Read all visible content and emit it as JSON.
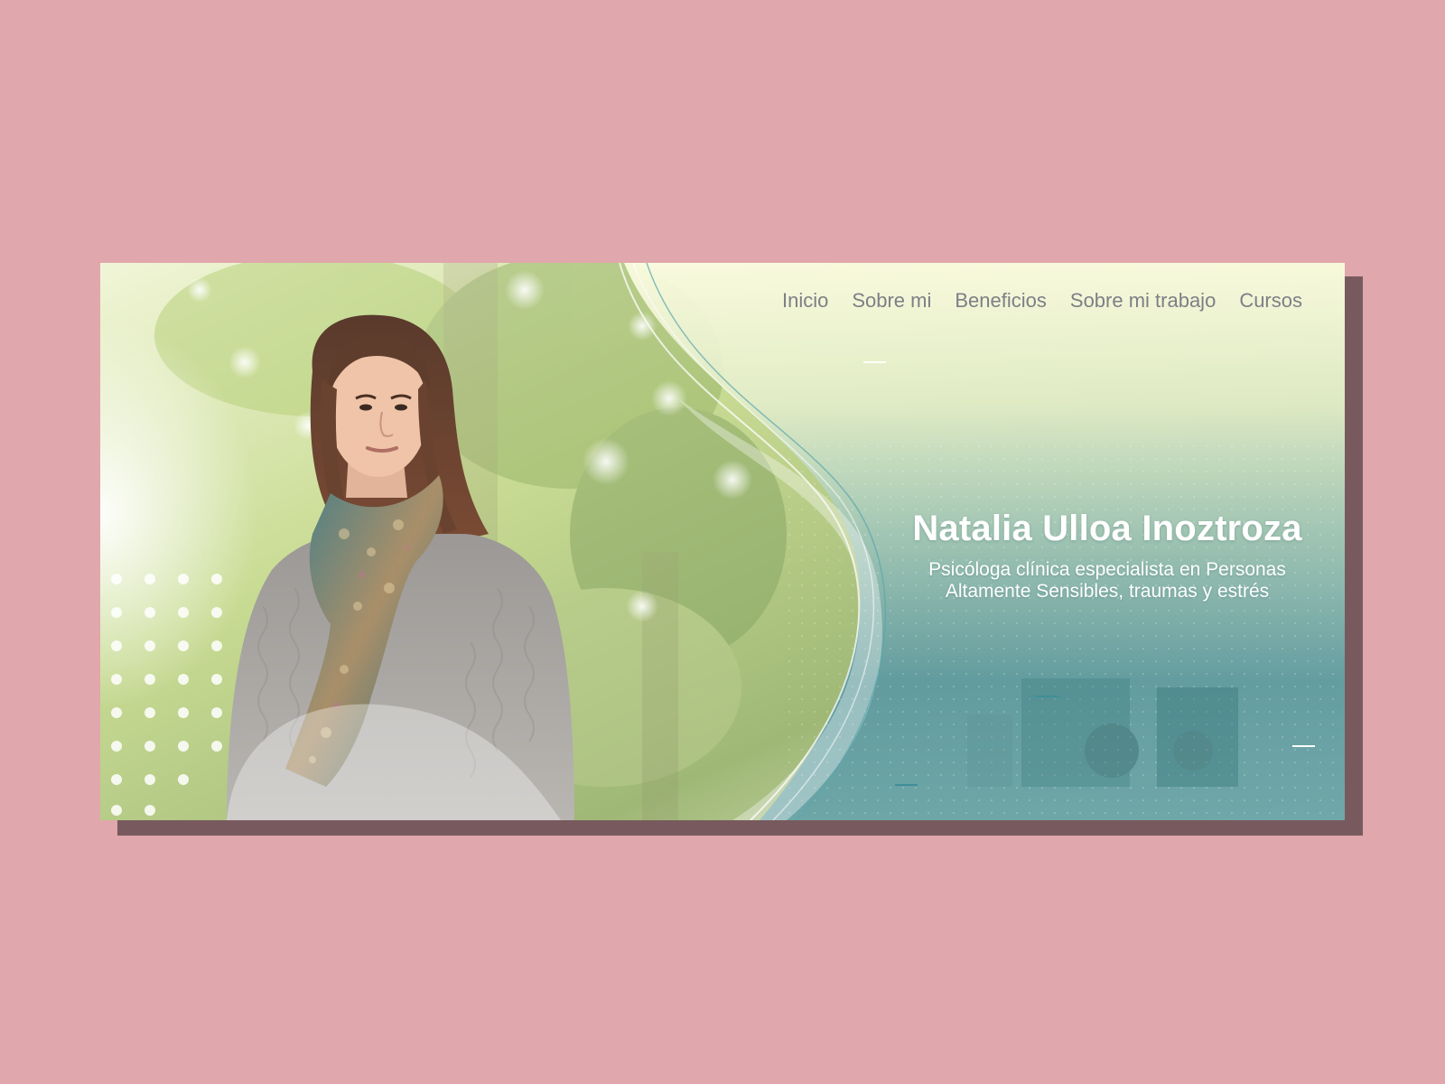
{
  "nav": {
    "items": [
      {
        "label": "Inicio"
      },
      {
        "label": "Sobre mi"
      },
      {
        "label": "Beneficios"
      },
      {
        "label": "Sobre mi trabajo"
      },
      {
        "label": "Cursos"
      }
    ]
  },
  "hero": {
    "name": "Natalia Ulloa Inoztroza",
    "subtitle_line1": "Psicóloga clínica especialista en Personas",
    "subtitle_line2": "Altamente Sensibles, traumas y estrés",
    "photo": "portrait-photo"
  },
  "colors": {
    "page_background": "#e0a7ac",
    "card_shadow": "#785a5e",
    "nav_text": "#7d7f86",
    "title_text": "#ffffff",
    "teal_accent": "#5d9ba3",
    "soft_yellow": "#f4f6c8"
  }
}
